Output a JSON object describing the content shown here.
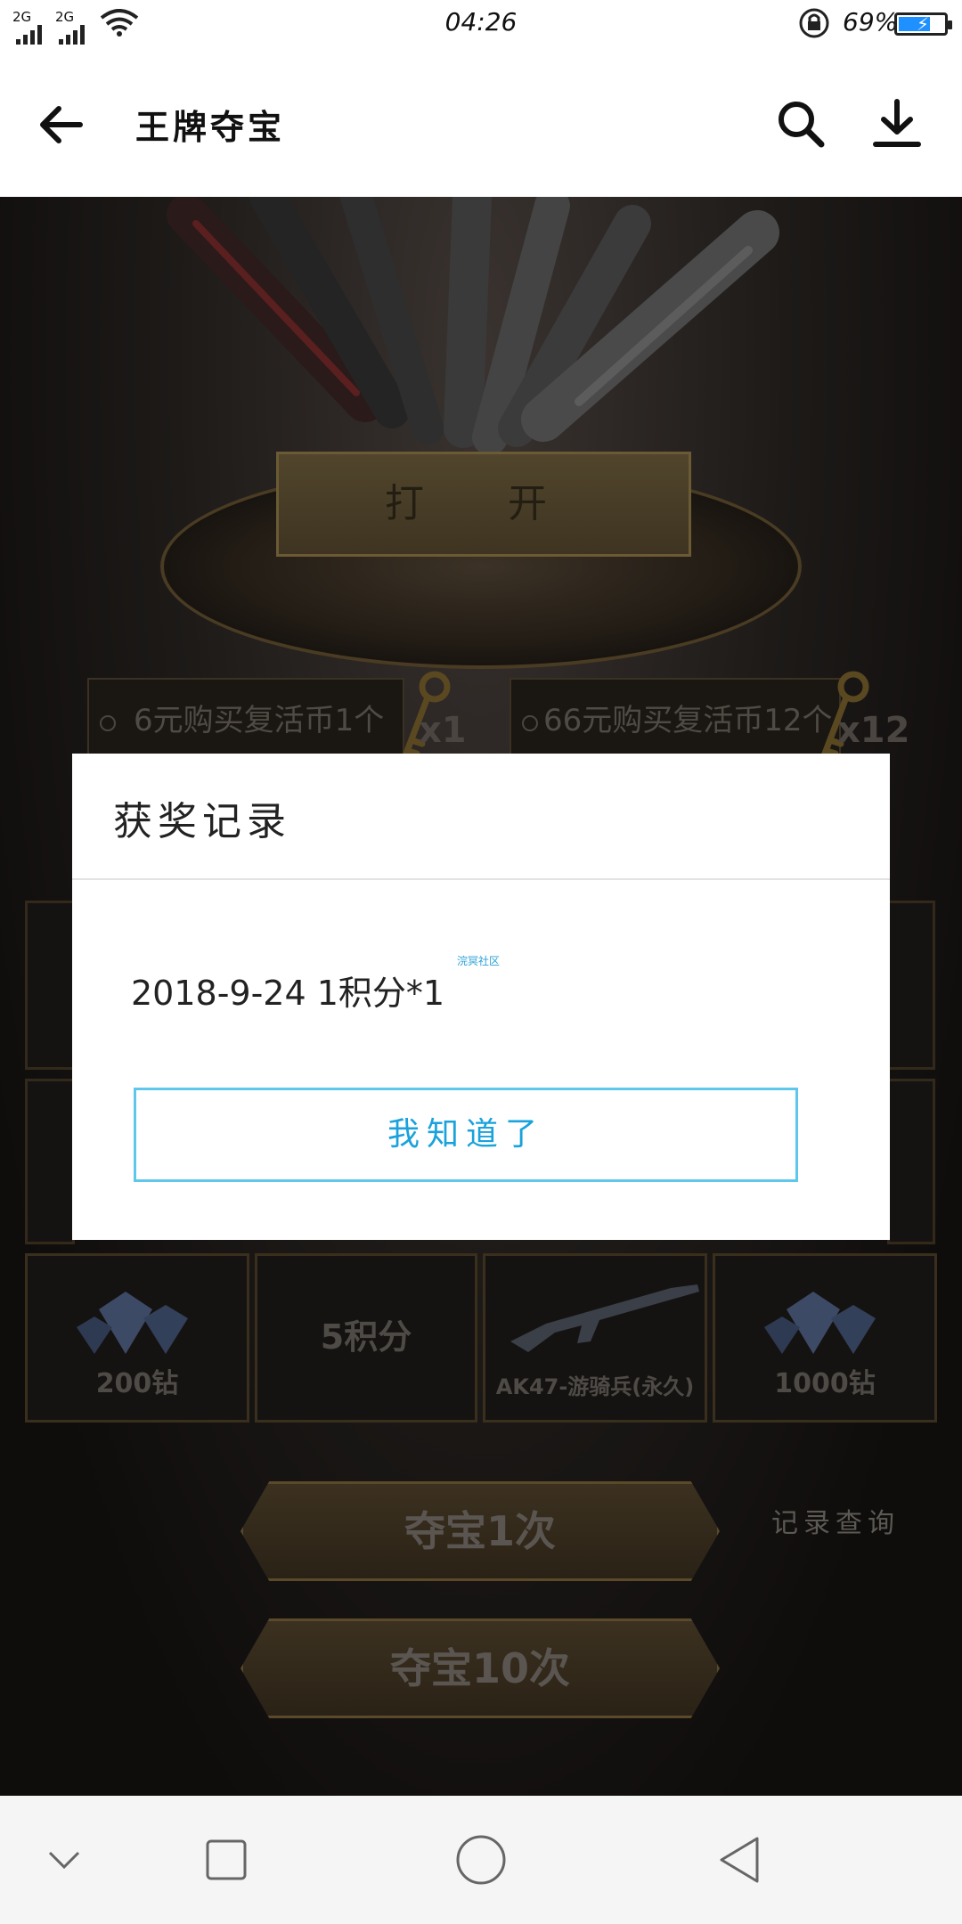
{
  "status_bar": {
    "network1": "2G",
    "network2": "2G",
    "time": "04:26",
    "battery_percent": "69%",
    "battery_level": 0.69
  },
  "app_bar": {
    "title": "王牌夺宝"
  },
  "game": {
    "open_label": "打 开",
    "buy_options": [
      {
        "label": "6元购买复活币1个",
        "multiplier": "x1"
      },
      {
        "label": "66元购买复活币12个",
        "multiplier": "x12"
      }
    ],
    "prizes": [
      {
        "label": "200钻",
        "icon": "diamond-icon"
      },
      {
        "label": "5积分",
        "icon": ""
      },
      {
        "label": "AK47-游骑兵(永久)",
        "icon": "rifle-icon"
      },
      {
        "label": "1000钻",
        "icon": "diamond-icon"
      }
    ],
    "draw_once": "夺宝1次",
    "draw_ten": "夺宝10次",
    "record_query": "记录查询"
  },
  "dialog": {
    "title": "获奖记录",
    "record_text": "2018-9-24   1积分*1",
    "watermark": "浣冥社区",
    "ok_label": "我知道了"
  },
  "colors": {
    "accent": "#19a2dc",
    "dialog_border": "#5fc7ec",
    "battery": "#1e90ff"
  }
}
